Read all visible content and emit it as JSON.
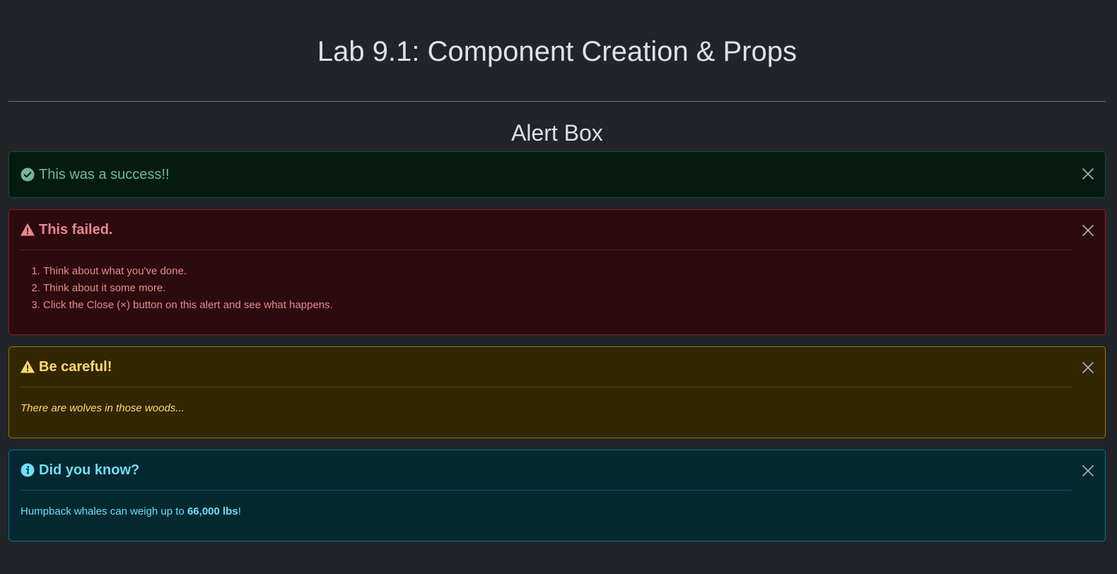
{
  "page": {
    "title": "Lab 9.1: Component Creation & Props",
    "section_title": "Alert Box"
  },
  "alerts": {
    "success": {
      "heading": "This was a success!!",
      "icon": "check-circle-icon",
      "color": "#75b798"
    },
    "danger": {
      "heading": "This failed.",
      "icon": "exclamation-triangle-icon",
      "color": "#ea868f",
      "items": [
        "Think about what you've done.",
        "Think about it some more.",
        "Click the Close (×) button on this alert and see what happens."
      ]
    },
    "warning": {
      "heading": "Be careful!",
      "icon": "exclamation-triangle-icon",
      "color": "#ffda6a",
      "body": "There are wolves in those woods..."
    },
    "info": {
      "heading": "Did you know?",
      "icon": "info-circle-icon",
      "color": "#6edff6",
      "body_prefix": "Humpback whales can weigh up to ",
      "body_emphasis": "66,000 lbs",
      "body_suffix": "!"
    }
  },
  "close_label": "Close"
}
